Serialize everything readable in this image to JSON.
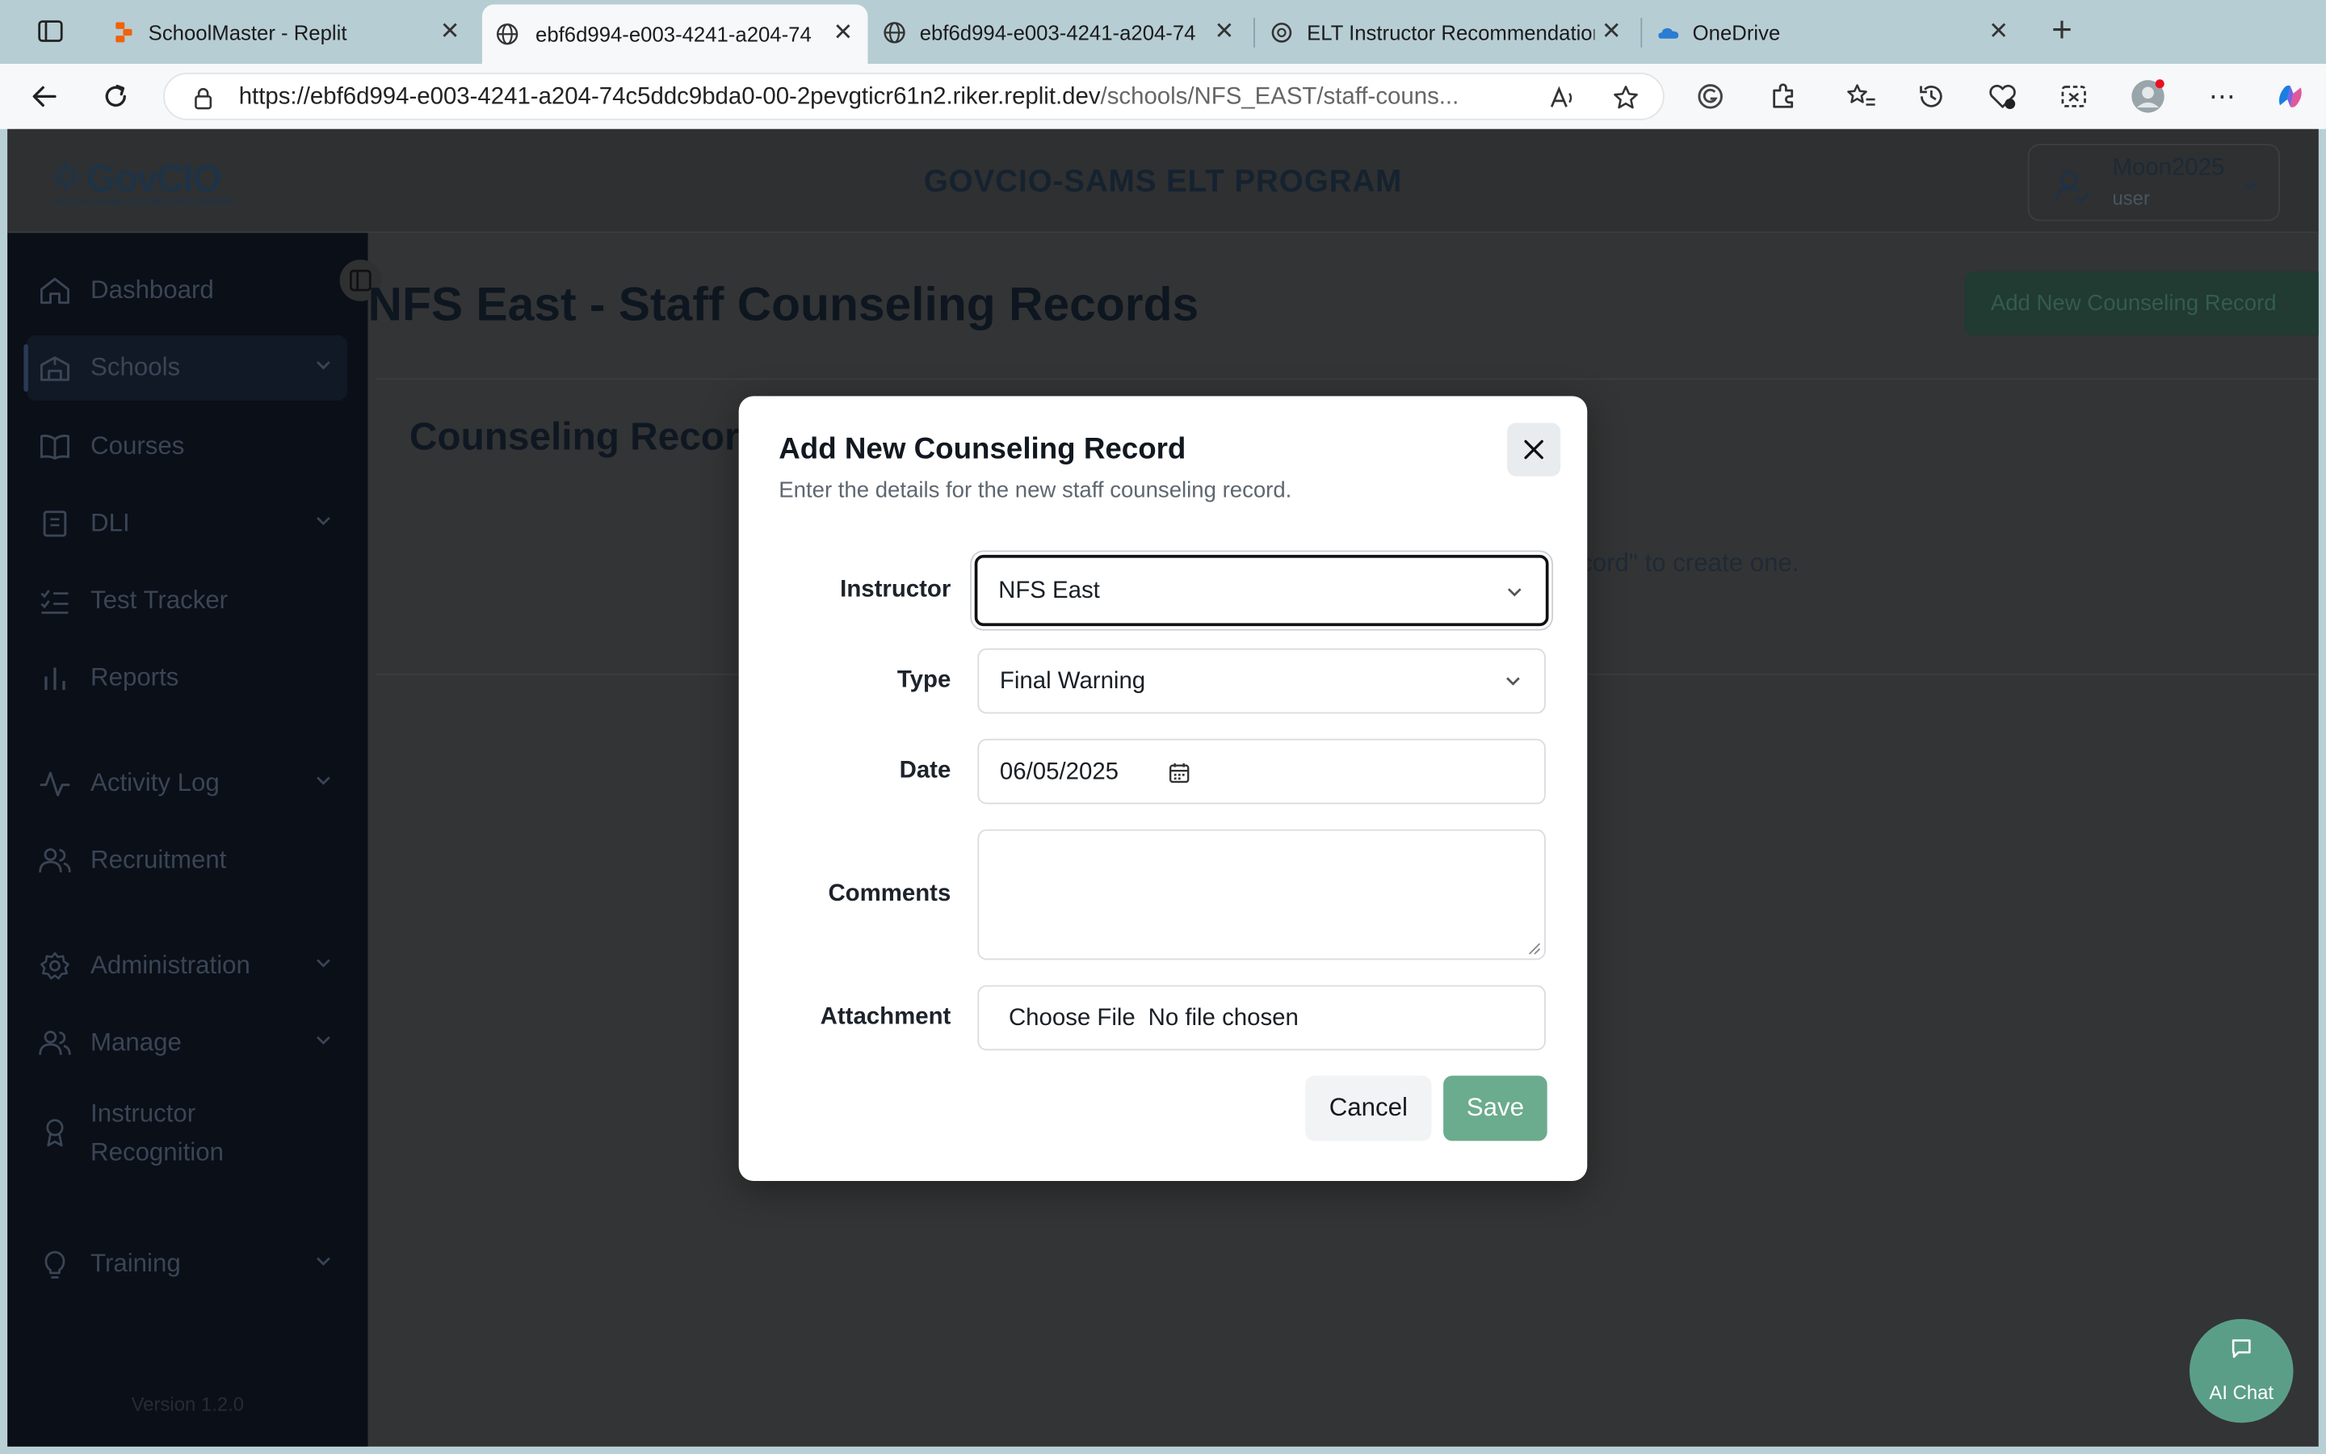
{
  "browser": {
    "tabs": [
      {
        "title": "SchoolMaster - Replit",
        "active": false
      },
      {
        "title": "ebf6d994-e003-4241-a204-74",
        "active": true
      },
      {
        "title": "ebf6d994-e003-4241-a204-74",
        "active": false
      },
      {
        "title": "ELT Instructor Recommendation",
        "active": false
      },
      {
        "title": "OneDrive",
        "active": false
      }
    ],
    "url_main": "https://ebf6d994-e003-4241-a204-74c5ddc9bda0-00-2pevgticr61n2.riker.replit.dev",
    "url_path": "/schools/NFS_EAST/staff-couns..."
  },
  "app": {
    "logo_text": "GovCIO",
    "logo_tagline": "SALIENT ARABIA FOR MILITARY SUPPORT",
    "title": "GOVCIO-SAMS ELT PROGRAM",
    "user": {
      "name": "Moon2025",
      "role": "user"
    }
  },
  "sidebar": {
    "items": [
      {
        "label": "Dashboard",
        "icon": "home-icon",
        "has_chevron": false
      },
      {
        "label": "Schools",
        "icon": "building-icon",
        "has_chevron": true
      },
      {
        "label": "Courses",
        "icon": "book-open-icon",
        "has_chevron": false
      },
      {
        "label": "DLI",
        "icon": "book-icon",
        "has_chevron": true
      },
      {
        "label": "Test Tracker",
        "icon": "list-check-icon",
        "has_chevron": false
      },
      {
        "label": "Reports",
        "icon": "bar-chart-icon",
        "has_chevron": false
      },
      {
        "label": "Activity Log",
        "icon": "activity-icon",
        "has_chevron": true
      },
      {
        "label": "Recruitment",
        "icon": "users-icon",
        "has_chevron": false
      },
      {
        "label": "Administration",
        "icon": "gear-icon",
        "has_chevron": true
      },
      {
        "label": "Manage",
        "icon": "users-icon",
        "has_chevron": true
      },
      {
        "label": "Instructor Recognition",
        "icon": "award-icon",
        "has_chevron": false
      },
      {
        "label": "Training",
        "icon": "lightbulb-icon",
        "has_chevron": true
      }
    ],
    "version": "Version 1.2.0"
  },
  "main": {
    "page_title": "NFS East - Staff Counseling Records",
    "add_button": "Add New Counseling Record",
    "records_title": "Counseling Records",
    "empty_text": "cord\" to create one."
  },
  "modal": {
    "title": "Add New Counseling Record",
    "subtitle": "Enter the details for the new staff counseling record.",
    "fields": {
      "instructor": {
        "label": "Instructor",
        "value": "NFS East"
      },
      "type": {
        "label": "Type",
        "value": "Final Warning"
      },
      "date": {
        "label": "Date",
        "value": "06/05/2025"
      },
      "comments": {
        "label": "Comments",
        "value": ""
      },
      "attachment": {
        "label": "Attachment",
        "button": "Choose File",
        "status": "No file chosen"
      }
    },
    "cancel_label": "Cancel",
    "save_label": "Save"
  },
  "ai_chat": {
    "label": "AI Chat"
  },
  "colors": {
    "accent_green": "#6bab8e",
    "sidebar_bg": "#0b0f17",
    "overlay_bg": "#333435"
  }
}
